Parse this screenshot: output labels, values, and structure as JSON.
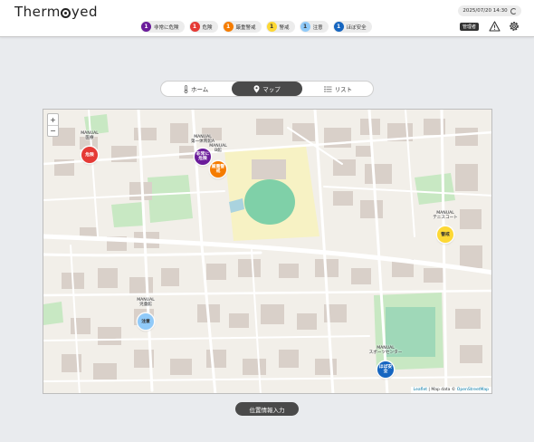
{
  "app": {
    "logo_prefix": "Therm",
    "logo_suffix": "yed",
    "datetime": "2025/07/20 14:30",
    "admin_badge": "管理者"
  },
  "legend": [
    {
      "num": "1",
      "label": "非常に危険",
      "color": "#6a1b9a"
    },
    {
      "num": "1",
      "label": "危険",
      "color": "#e53935"
    },
    {
      "num": "1",
      "label": "厳重警戒",
      "color": "#f57c00"
    },
    {
      "num": "1",
      "label": "警戒",
      "color": "#fdd835"
    },
    {
      "num": "1",
      "label": "注意",
      "color": "#90caf9"
    },
    {
      "num": "1",
      "label": "ほぼ安全",
      "color": "#1565c0"
    }
  ],
  "tabs": [
    {
      "label": "ホーム",
      "icon": "thermometer-icon"
    },
    {
      "label": "マップ",
      "icon": "map-pin-icon"
    },
    {
      "label": "リスト",
      "icon": "list-icon"
    }
  ],
  "map": {
    "zoom_in": "+",
    "zoom_out": "−",
    "attribution_leaflet": "Leaflet",
    "attribution_sep": " | Map data © ",
    "attribution_osm": "OpenStreetMap",
    "markers": [
      {
        "tag": "MANUAL",
        "name": "医療",
        "pin": "危険",
        "color": "#e53935",
        "text": "#fff"
      },
      {
        "tag": "MANUAL",
        "name": "第一体育館A",
        "pin": "非常に危険",
        "color": "#6a1b9a",
        "text": "#fff"
      },
      {
        "tag": "MANUAL",
        "name": "B館",
        "pin": "厳重警戒",
        "color": "#f57c00",
        "text": "#fff"
      },
      {
        "tag": "MANUAL",
        "name": "テニスコート",
        "pin": "警戒",
        "color": "#fdd835",
        "text": "#333"
      },
      {
        "tag": "MANUAL",
        "name": "児童館",
        "pin": "注意",
        "color": "#90caf9",
        "text": "#333"
      },
      {
        "tag": "MANUAL",
        "name": "スポーツセンター",
        "pin": "ほぼ安全",
        "color": "#1565c0",
        "text": "#fff"
      }
    ]
  },
  "actions": {
    "submit_label": "位置情報入力"
  },
  "colors": {
    "header_bg": "#ffffff",
    "page_bg": "#e9ebee",
    "dark_button": "#4a4a4a"
  }
}
